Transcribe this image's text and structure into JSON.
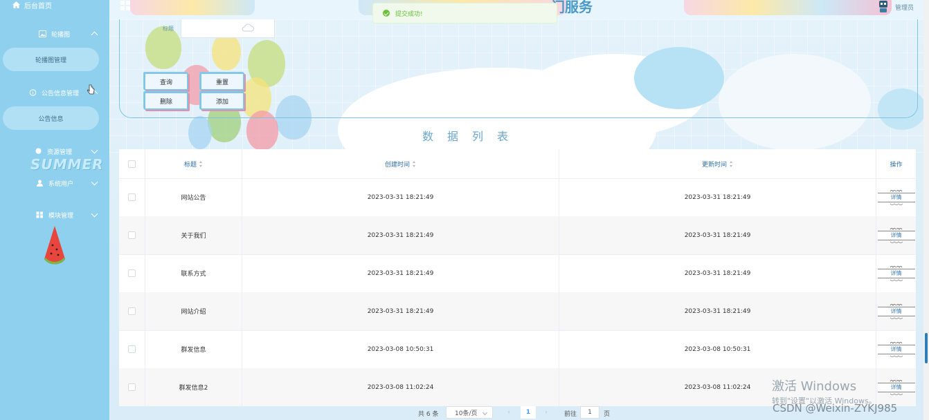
{
  "sidebar": {
    "home": "后台首页",
    "groups": [
      {
        "label": "轮播图",
        "expanded": true,
        "items": [
          "轮播图管理"
        ]
      },
      {
        "label": "公告信息管理",
        "expanded": true,
        "items": [
          "公告信息"
        ]
      },
      {
        "label": "资源管理",
        "expanded": false
      },
      {
        "label": "系统用户",
        "expanded": false
      },
      {
        "label": "模块管理",
        "expanded": false
      }
    ],
    "decor_text": "SUMMER"
  },
  "header": {
    "title_fragment": "门服务",
    "user": "管理员"
  },
  "toast": {
    "message": "提交成功!"
  },
  "search": {
    "field_label": "标题",
    "field_value": "",
    "buttons": {
      "query": "查询",
      "reset": "重置",
      "delete": "删除",
      "add": "添加"
    }
  },
  "list_title": "数据列表",
  "table": {
    "columns": {
      "title": "标题",
      "created": "创建时间",
      "updated": "更新时间",
      "action": "操作"
    },
    "rows": [
      {
        "title": "网站公告",
        "created": "2023-03-31 18:21:49",
        "updated": "2023-03-31 18:21:49"
      },
      {
        "title": "关于我们",
        "created": "2023-03-31 18:21:49",
        "updated": "2023-03-31 18:21:49"
      },
      {
        "title": "联系方式",
        "created": "2023-03-31 18:21:49",
        "updated": "2023-03-31 18:21:49"
      },
      {
        "title": "网站介绍",
        "created": "2023-03-31 18:21:49",
        "updated": "2023-03-31 18:21:49"
      },
      {
        "title": "群发信息",
        "created": "2023-03-08 10:50:31",
        "updated": "2023-03-08 10:50:31"
      },
      {
        "title": "群发信息2",
        "created": "2023-03-08 11:02:24",
        "updated": "2023-03-08 11:02:24"
      }
    ],
    "detail_label": "详情"
  },
  "pagination": {
    "total": "共 6 条",
    "page_size": "10条/页",
    "current": "1",
    "goto_label": "前往",
    "goto_value": "1",
    "page_suffix": "页"
  },
  "overlay": {
    "activate_title": "激活 Windows",
    "activate_sub": "转到\"设置\"以激活 Windows。",
    "csdn": "CSDN @Weixin-ZYKJ985"
  },
  "colors": {
    "sidebar": "#8fd0ef",
    "accent": "#409eff",
    "success": "#67c23a"
  }
}
